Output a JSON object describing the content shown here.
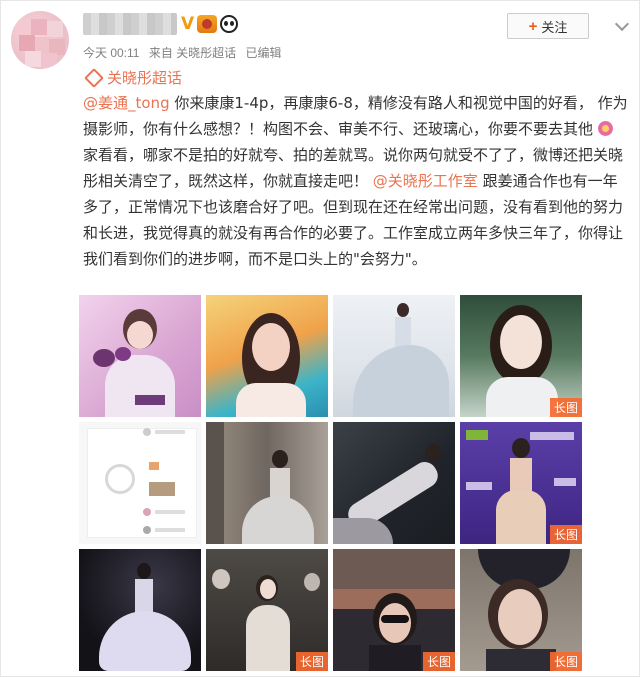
{
  "post": {
    "time": "今天 00:11",
    "source": "来自 关晓彤超话",
    "edited": "已编辑",
    "follow_label": "关注",
    "verified_mark": "V",
    "topic": "关晓彤超话"
  },
  "content": {
    "mention1": "@姜通_tong",
    "part1": " 你来康康1-4p，再康康6-8，精修没有路人和视觉中国的好看， 作为摄影师，你有什么感想？！构图不会、审美不行、还玻璃心，你要不要去其他",
    "part2": "家看看，哪家不是拍的好就夸、拍的差就骂。说你两句就受不了了，微博还把关晓彤相关清空了，既然这样，你就直接走吧！",
    "mention2": "@关晓彤工作室",
    "part3": " 跟姜通合作也有一年多了，正常情况下也该磨合好了吧。但到现在还在经常出问题，没有看到他的努力和长进，我觉得真的就没有再合作的必要了。工作室成立两年多快三年了，你得让我们看到你们的进步啊，而不是口头上的\"会努力\"。"
  },
  "images": {
    "long_label": "长图",
    "count": 12
  },
  "colors": {
    "accent": "#eb7350",
    "tag_bg": "#f66930",
    "meta": "#808080"
  },
  "icons": [
    "flower-emoji-icon",
    "topic-diamond-icon",
    "plus-icon",
    "chevron-down-icon",
    "verified-icon",
    "lion-badge-icon",
    "panda-badge-icon"
  ]
}
